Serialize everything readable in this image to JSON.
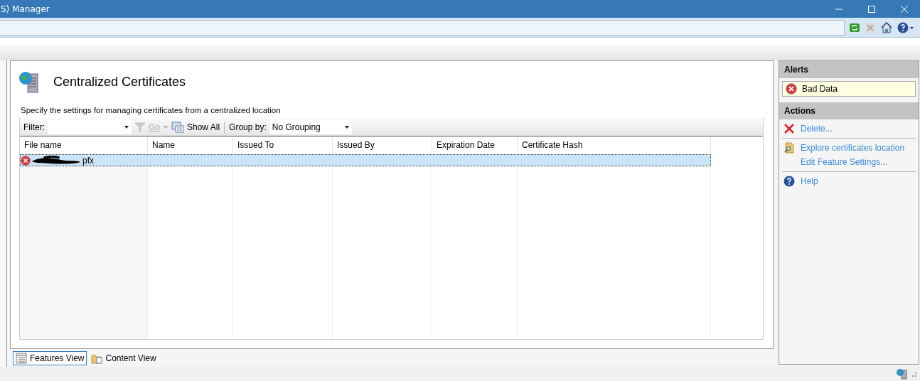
{
  "window": {
    "title": "S) Manager"
  },
  "page": {
    "title": "Centralized Certificates",
    "description": "Specify the settings for managing certificates from a centralized location"
  },
  "filter_bar": {
    "filter_label": "Filter:",
    "go": {
      "label": "Go",
      "disabled": true
    },
    "show_all": "Show All",
    "group_by_label": "Group by:",
    "group_by_value": "No Grouping"
  },
  "table": {
    "columns": [
      "File name",
      "Name",
      "Issued To",
      "Issued By",
      "Expiration Date",
      "Certificate Hash"
    ],
    "rows": [
      {
        "file_name": "pfx",
        "kind": "error",
        "selected": true
      }
    ]
  },
  "alerts": {
    "title": "Alerts",
    "items": [
      {
        "text": "Bad Data",
        "kind": "error"
      }
    ]
  },
  "actions": {
    "title": "Actions",
    "groups": [
      [
        {
          "label": "Delete...",
          "kind": "delete"
        }
      ],
      [
        {
          "label": "Explore certificates location",
          "kind": "explore"
        },
        {
          "label": "Edit Feature Settings...",
          "kind": "plain"
        }
      ],
      [
        {
          "label": "Help",
          "kind": "help"
        }
      ]
    ]
  },
  "view_tabs": [
    {
      "label": "Features View",
      "selected": true,
      "kind": "features"
    },
    {
      "label": "Content View",
      "selected": false,
      "kind": "content"
    }
  ]
}
